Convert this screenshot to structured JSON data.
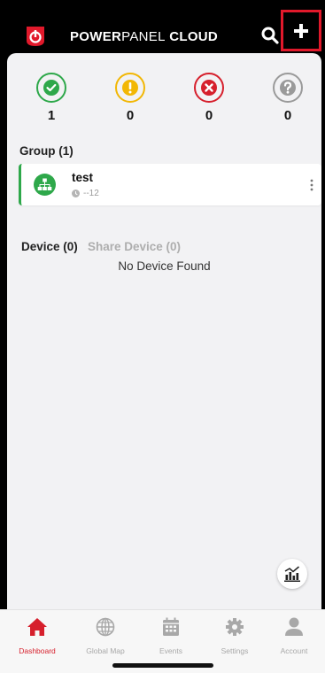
{
  "app": {
    "title_part1": "POWER",
    "title_part2": "PANEL",
    "title_part3": " CLOUD"
  },
  "colors": {
    "accent_red": "#e1192b",
    "ok": "#2ea84a",
    "warning": "#f2b705",
    "critical": "#d61f2c",
    "unknown": "#9a9a9a"
  },
  "status": [
    {
      "name": "normal",
      "icon": "check-icon",
      "count": "1"
    },
    {
      "name": "warning",
      "icon": "exclamation-icon",
      "count": "0"
    },
    {
      "name": "critical",
      "icon": "x-icon",
      "count": "0"
    },
    {
      "name": "unknown",
      "icon": "question-icon",
      "count": "0"
    }
  ],
  "group_section": {
    "label": "Group (1)",
    "items": [
      {
        "name": "test",
        "meta": "--12"
      }
    ]
  },
  "device_section": {
    "device_tab": "Device (0)",
    "share_tab": "Share Device (0)",
    "empty_message": "No Device Found"
  },
  "bottom_nav": [
    {
      "label": "Dashboard",
      "icon": "home-icon",
      "active": true
    },
    {
      "label": "Global Map",
      "icon": "globe-icon",
      "active": false
    },
    {
      "label": "Events",
      "icon": "calendar-icon",
      "active": false
    },
    {
      "label": "Settings",
      "icon": "gear-icon",
      "active": false
    },
    {
      "label": "Account",
      "icon": "user-icon",
      "active": false
    }
  ]
}
